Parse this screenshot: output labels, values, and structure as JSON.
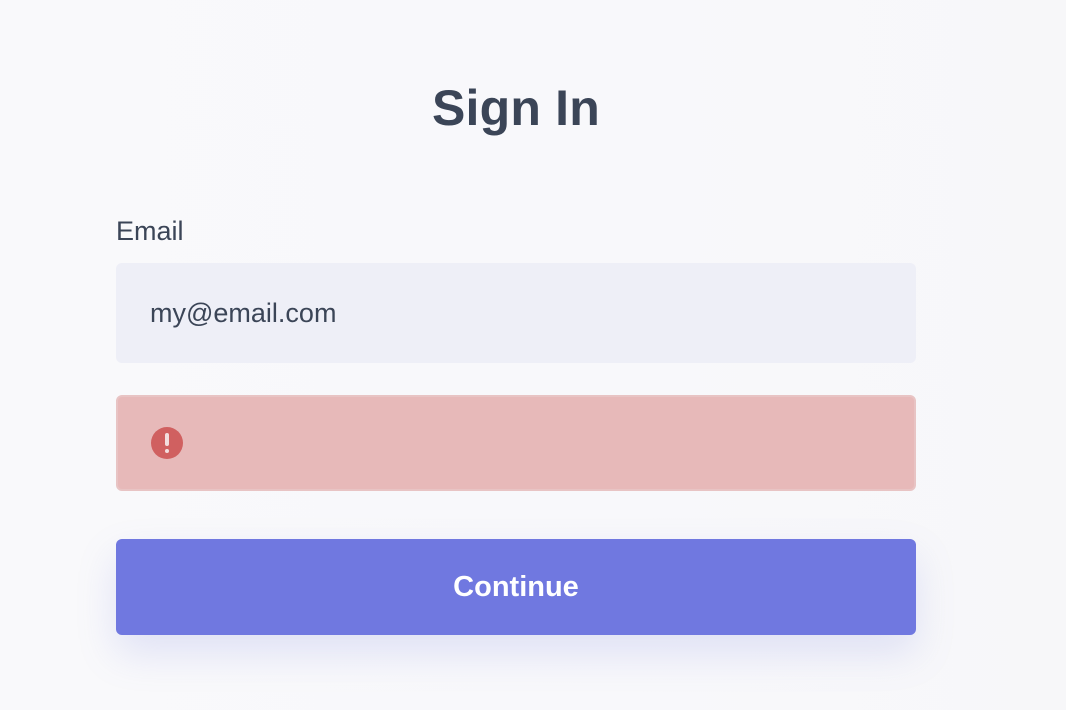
{
  "form": {
    "title": "Sign In",
    "email_label": "Email",
    "email_value": "my@email.com",
    "alert_message": "",
    "continue_label": "Continue"
  },
  "colors": {
    "title": "#3b4557",
    "input_background": "#eeeff7",
    "alert_background": "#e7b9b9",
    "alert_icon": "#d06060",
    "button_background": "#7078e0",
    "button_text": "#ffffff"
  },
  "icons": {
    "alert": "exclamation-circle-icon"
  }
}
